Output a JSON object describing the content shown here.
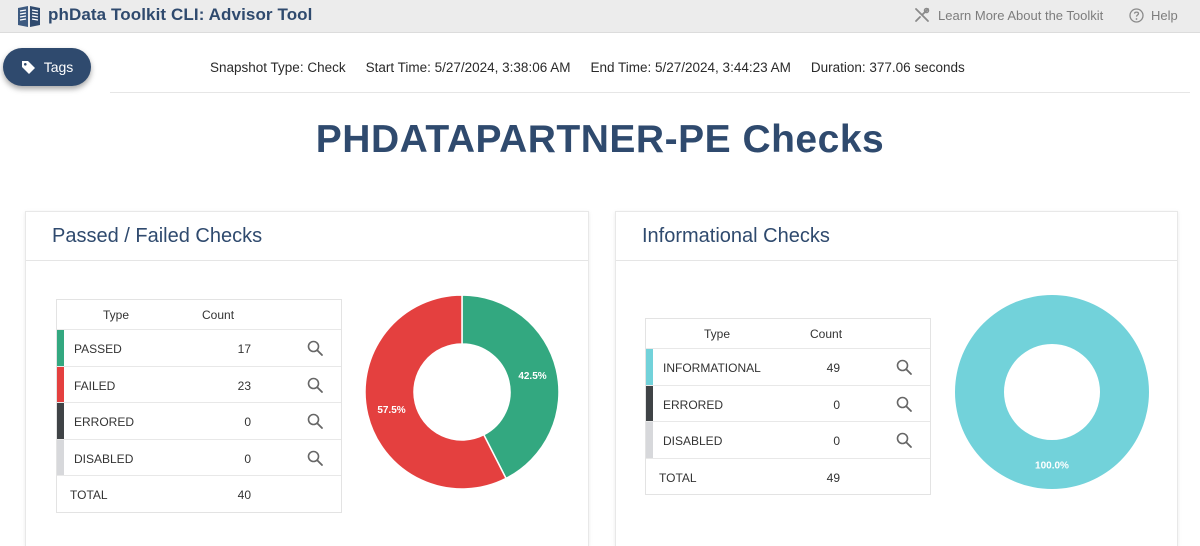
{
  "app": {
    "title": "phData Toolkit CLI: Advisor Tool"
  },
  "header": {
    "learn_more": "Learn More About the Toolkit",
    "help": "Help"
  },
  "tags_button": {
    "label": "Tags"
  },
  "snapshot": {
    "type": "Snapshot Type: Check",
    "start": "Start Time: 5/27/2024, 3:38:06 AM",
    "end": "End Time: 5/27/2024, 3:44:23 AM",
    "duration": "Duration: 377.06 seconds"
  },
  "page_title": "PHDATAPARTNER-PE Checks",
  "colors": {
    "passed": "#33a880",
    "failed": "#e4403f",
    "errored": "#3f4346",
    "disabled": "#d7d8db",
    "informational": "#72d2da",
    "brand": "#2f4a6e"
  },
  "passed_failed": {
    "title": "Passed / Failed Checks",
    "header": {
      "type": "Type",
      "count": "Count"
    },
    "rows": [
      {
        "label": "PASSED",
        "count": "17",
        "color": "#33a880"
      },
      {
        "label": "FAILED",
        "count": "23",
        "color": "#e4403f"
      },
      {
        "label": "ERRORED",
        "count": "0",
        "color": "#3f4346"
      },
      {
        "label": "DISABLED",
        "count": "0",
        "color": "#d7d8db"
      }
    ],
    "total": {
      "label": "TOTAL",
      "count": "40"
    },
    "chart_data": {
      "type": "pie",
      "slices": [
        {
          "label": "Passed",
          "value": 42.5,
          "label_text": "42.5%",
          "color": "#33a880"
        },
        {
          "label": "Failed",
          "value": 57.5,
          "label_text": "57.5%",
          "color": "#e4403f"
        }
      ]
    }
  },
  "informational": {
    "title": "Informational Checks",
    "header": {
      "type": "Type",
      "count": "Count"
    },
    "rows": [
      {
        "label": "INFORMATIONAL",
        "count": "49",
        "color": "#72d2da"
      },
      {
        "label": "ERRORED",
        "count": "0",
        "color": "#3f4346"
      },
      {
        "label": "DISABLED",
        "count": "0",
        "color": "#d7d8db"
      }
    ],
    "total": {
      "label": "TOTAL",
      "count": "49"
    },
    "chart_data": {
      "type": "pie",
      "slices": [
        {
          "label": "Informational",
          "value": 100.0,
          "label_text": "100.0%",
          "color": "#72d2da"
        }
      ]
    }
  }
}
